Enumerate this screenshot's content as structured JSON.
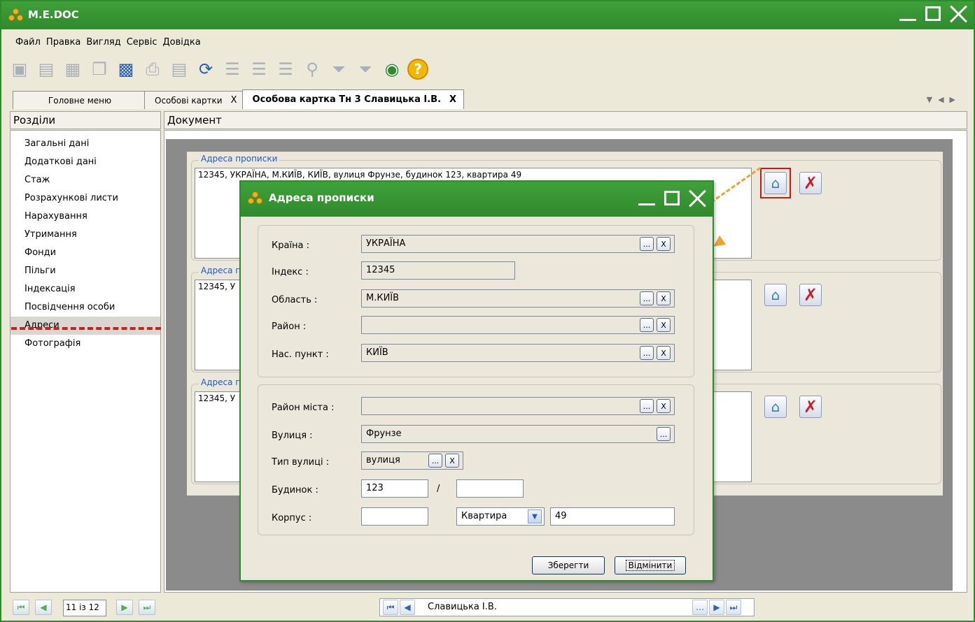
{
  "app": {
    "title": "M.E.DOC"
  },
  "menu": [
    "Файл",
    "Правка",
    "Вигляд",
    "Сервіс",
    "Довідка"
  ],
  "tabs": [
    {
      "label": "Головне меню"
    },
    {
      "label": "Особові картки",
      "close": "X"
    },
    {
      "label": "Особова картка Тн 3 Славицька І.В.",
      "close": "X"
    }
  ],
  "panels": {
    "sections_title": "Розділи",
    "document_title": "Документ"
  },
  "sidebar": {
    "items": [
      "Загальні дані",
      "Додаткові дані",
      "Стаж",
      "Розрахункові листи",
      "Нарахування",
      "Утримання",
      "Фонди",
      "Пільги",
      "Індексація",
      "Посвідчення особи",
      "Адреси",
      "Фотографія"
    ],
    "selected": "Адреси"
  },
  "addresses": [
    {
      "legend": "Адреса прописки",
      "text": "12345, УКРАЇНА, М.КИЇВ, КИЇВ, вулиця Фрунзе, будинок 123, квартира 49"
    },
    {
      "legend": "Адреса п",
      "text": "12345, У"
    },
    {
      "legend": "Адреса п",
      "text": "12345, У"
    }
  ],
  "dialog": {
    "title": "Адреса прописки",
    "country_label": "Країна :",
    "country": "УКРАЇНА",
    "index_label": "Індекс :",
    "index": "12345",
    "region_label": "Область :",
    "region": "М.КИЇВ",
    "district_label": "Район :",
    "district": "",
    "settlement_label": "Нас. пункт :",
    "settlement": "КИЇВ",
    "city_district_label": "Район міста :",
    "city_district": "",
    "street_label": "Вулиця :",
    "street": "Фрунзе",
    "street_type_label": "Тип вулиці :",
    "street_type": "вулиця",
    "house_label": "Будинок :",
    "house": "123",
    "house_sep": "/",
    "house_fraction": "",
    "building_label": "Корпус :",
    "building": "",
    "apartment_type": "Квартира",
    "apartment": "49",
    "save": "Зберегти",
    "cancel": "Відмінити",
    "ellipsis": "...",
    "clear": "X"
  },
  "status": {
    "record": "11 із 12",
    "person": "Славицька І.В."
  },
  "colors": {
    "title_green": "#2f8a2c",
    "highlight_red": "#c61a1a",
    "arrow_orange": "#f0a030",
    "link_blue": "#2255cc"
  }
}
